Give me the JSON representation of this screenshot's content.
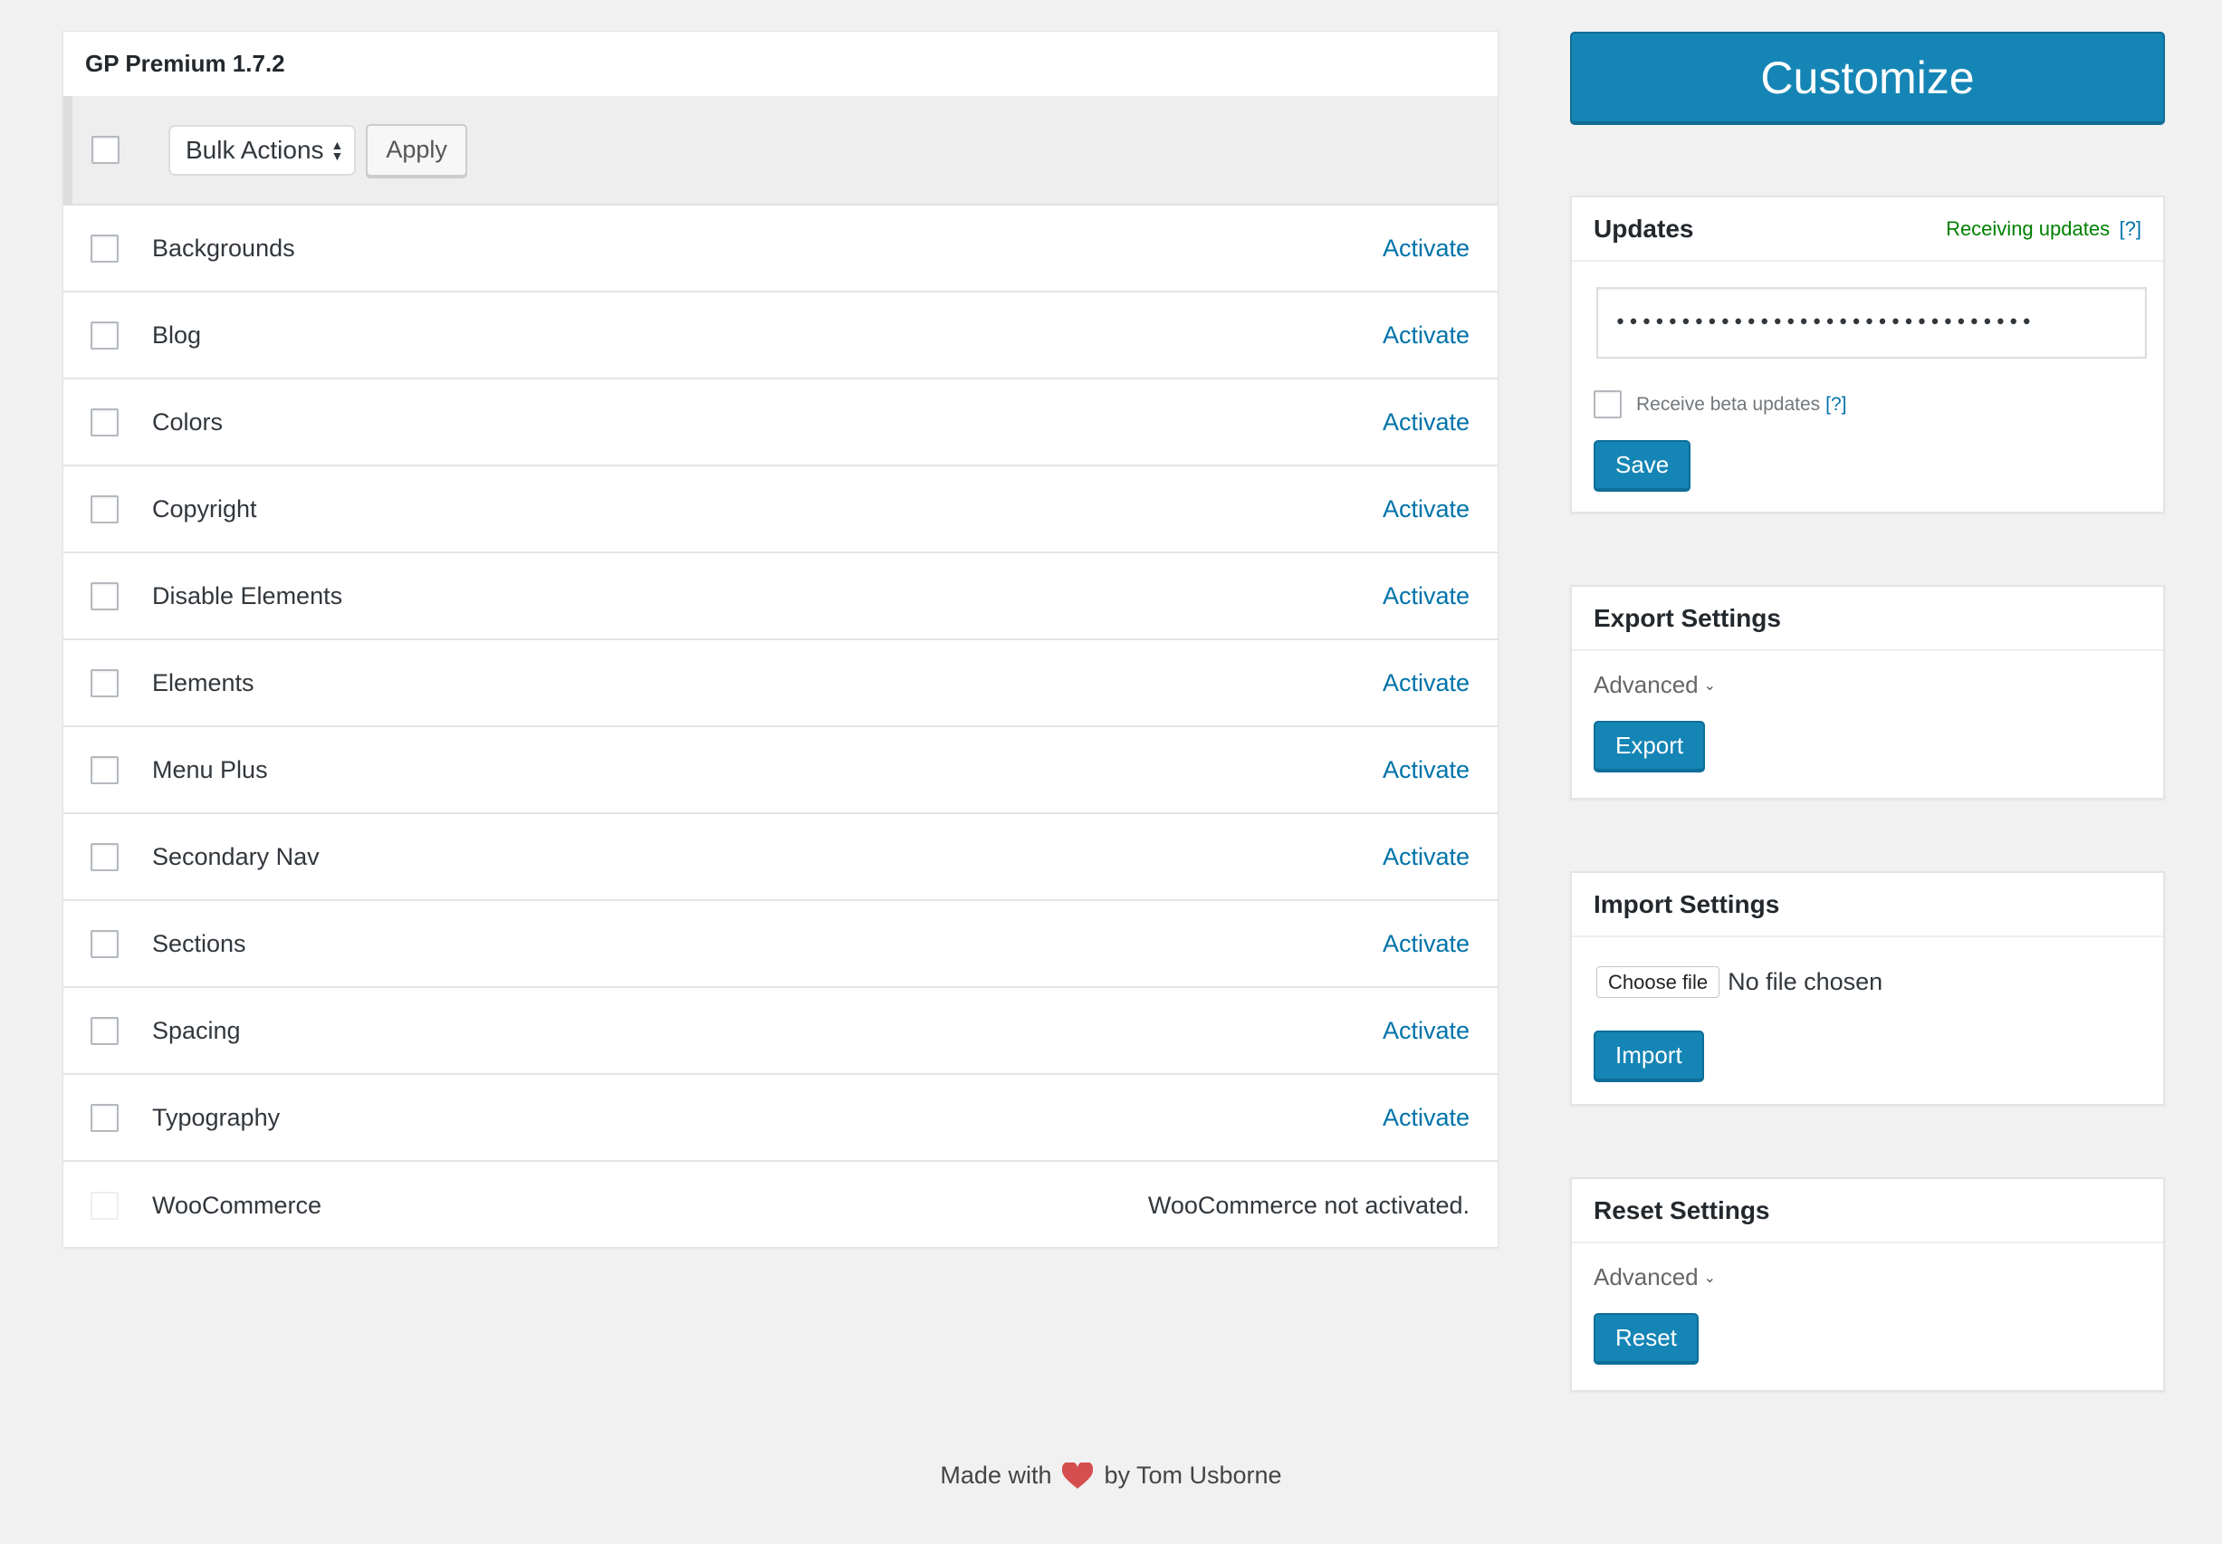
{
  "modules_panel": {
    "title": "GP Premium 1.7.2",
    "bulk_actions": {
      "select_label": "Bulk Actions",
      "apply_label": "Apply"
    },
    "modules": [
      {
        "name": "Backgrounds",
        "action": "Activate"
      },
      {
        "name": "Blog",
        "action": "Activate"
      },
      {
        "name": "Colors",
        "action": "Activate"
      },
      {
        "name": "Copyright",
        "action": "Activate"
      },
      {
        "name": "Disable Elements",
        "action": "Activate"
      },
      {
        "name": "Elements",
        "action": "Activate"
      },
      {
        "name": "Menu Plus",
        "action": "Activate"
      },
      {
        "name": "Secondary Nav",
        "action": "Activate"
      },
      {
        "name": "Sections",
        "action": "Activate"
      },
      {
        "name": "Spacing",
        "action": "Activate"
      },
      {
        "name": "Typography",
        "action": "Activate"
      },
      {
        "name": "WooCommerce",
        "status": "WooCommerce not activated.",
        "disabled": true
      }
    ]
  },
  "customize_button": {
    "label": "Customize"
  },
  "updates": {
    "title": "Updates",
    "status": "Receiving updates",
    "help": "[?]",
    "license_value": "••••••••••••••••••••••••••••••••",
    "beta_label": "Receive beta updates",
    "beta_help": "[?]",
    "save_label": "Save"
  },
  "export_settings": {
    "title": "Export Settings",
    "advanced_label": "Advanced",
    "button_label": "Export"
  },
  "import_settings": {
    "title": "Import Settings",
    "choose_file_label": "Choose file",
    "file_status": "No file chosen",
    "button_label": "Import"
  },
  "reset_settings": {
    "title": "Reset Settings",
    "advanced_label": "Advanced",
    "button_label": "Reset"
  },
  "footer": {
    "made_with": "Made with",
    "by": "by Tom Usborne",
    "heart_icon": "heart-icon"
  },
  "colors": {
    "primary_button": "#1585b5",
    "link": "#0073aa",
    "status_ok": "#008000",
    "heart": "#d54e50"
  }
}
